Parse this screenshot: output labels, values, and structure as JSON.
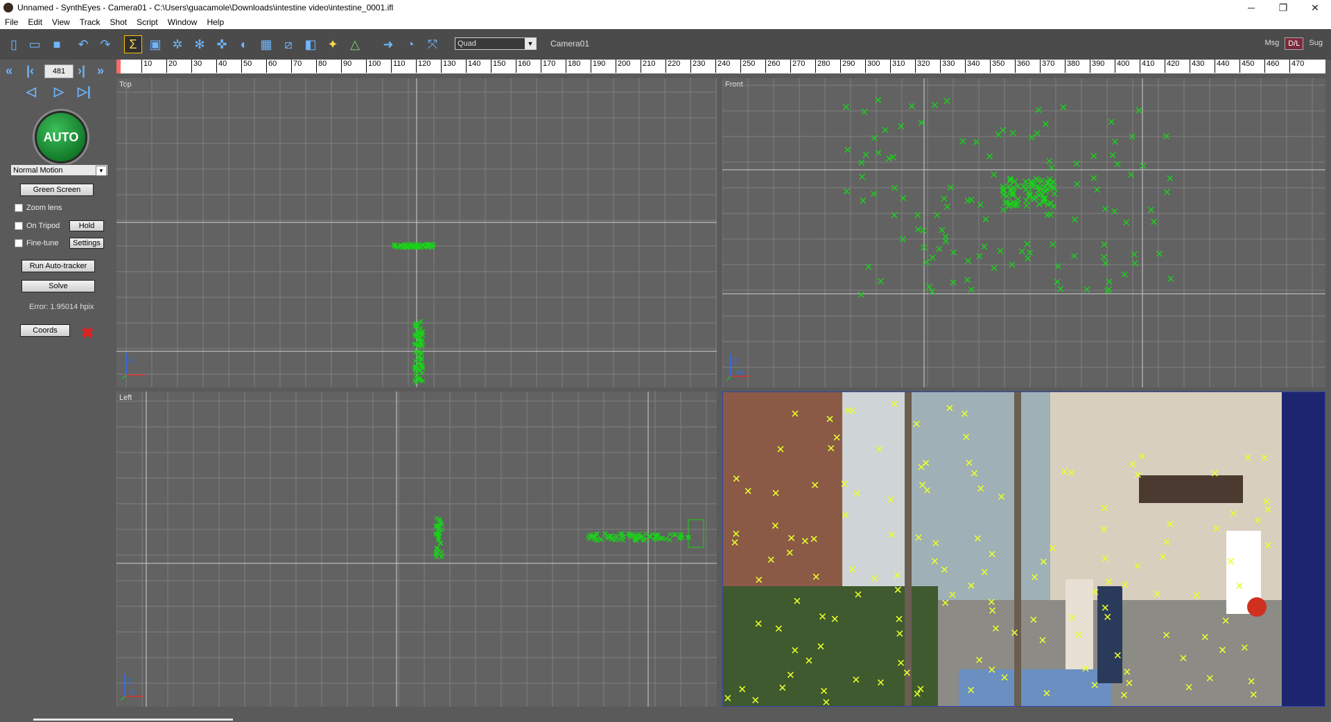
{
  "window": {
    "title": "Unnamed - SynthEyes - Camera01 - C:\\Users\\guacamole\\Downloads\\intestine video\\intestine_0001.ifl",
    "minimize": "─",
    "maximize": "❐",
    "close": "✕"
  },
  "menu": [
    "File",
    "Edit",
    "View",
    "Track",
    "Shot",
    "Script",
    "Window",
    "Help"
  ],
  "toolbar": {
    "layout_value": "Quad",
    "camera_label": "Camera01",
    "msg_label": "Msg",
    "dl_label": "D/L",
    "sug_label": "Sug",
    "icons": [
      "new-file-icon",
      "open-folder-icon",
      "save-icon",
      "undo-icon",
      "redo-icon",
      "summary-sigma-icon",
      "camera-view-icon",
      "solver-gear-icon",
      "feature-gear-icon",
      "tracker-move-icon",
      "lens-icon",
      "spreadsheet-icon",
      "graph-editor-icon",
      "3d-cube-icon",
      "light-bulb-icon",
      "perspective-icon",
      "forward-arrow-icon",
      "clock-icon",
      "fit-view-icon"
    ]
  },
  "left_panel": {
    "frame_number": "481",
    "auto_label": "AUTO",
    "motion_mode": "Normal Motion",
    "green_screen": "Green Screen",
    "zoom_lens": "Zoom lens",
    "on_tripod": "On Tripod",
    "hold": "Hold",
    "fine_tune": "Fine-tune",
    "settings": "Settings",
    "run_autotracker": "Run Auto-tracker",
    "solve": "Solve",
    "error": "Error: 1.95014 hpix",
    "coords": "Coords"
  },
  "timeline": {
    "ticks": [
      "10",
      "20",
      "30",
      "40",
      "50",
      "60",
      "70",
      "80",
      "90",
      "100",
      "110",
      "120",
      "130",
      "140",
      "150",
      "160",
      "170",
      "180",
      "190",
      "200",
      "210",
      "220",
      "230",
      "240",
      "250",
      "260",
      "270",
      "280",
      "290",
      "300",
      "310",
      "320",
      "330",
      "340",
      "350",
      "360",
      "370",
      "380",
      "390",
      "400",
      "410",
      "420",
      "430",
      "440",
      "450",
      "460",
      "470"
    ]
  },
  "viewports": {
    "top_label": "Top",
    "front_label": "Front",
    "left_label": "Left",
    "axis_top": "Z",
    "axis_front_z": "Z",
    "axis_front_y": "Ya",
    "axis_left_z": "Z",
    "axis_left_y": "Y"
  },
  "colors": {
    "tracker_green": "#18d418",
    "tracker_yellow": "#e8ff2a",
    "viewport_bg": "#626262",
    "grid_line": "#808080"
  }
}
